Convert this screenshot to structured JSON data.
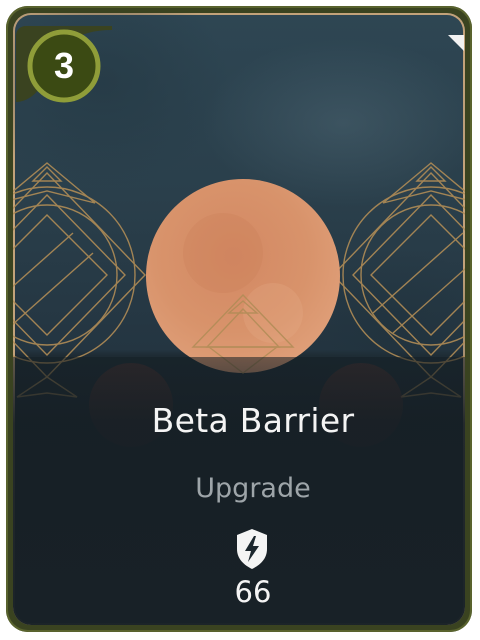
{
  "card": {
    "cost": "3",
    "name": "Beta Barrier",
    "type": "Upgrade",
    "stat_icon": "shield-lightning-icon",
    "stat_value": "66"
  },
  "colors": {
    "frame_outer": "#3a4320",
    "frame_inner_gold": "#c2a27a",
    "background_top": "#2e4653",
    "background_bottom": "#1b262d",
    "orb": "#d9936b",
    "cost_badge_fill": "#3b4a13",
    "cost_badge_ring": "#8f9d39",
    "ornament_gold": "#b08c56",
    "text_primary": "#f4f4f4",
    "text_secondary": "#9ea5a9"
  }
}
